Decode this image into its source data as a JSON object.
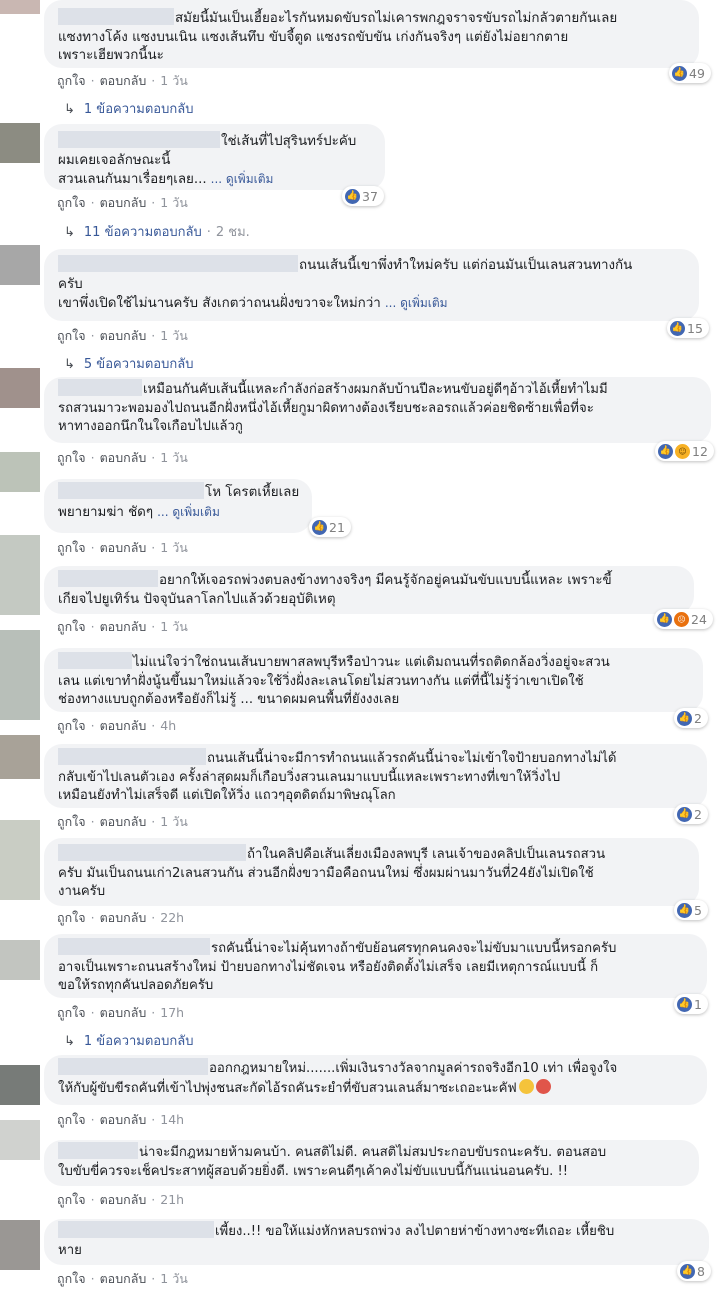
{
  "actions": {
    "like": "ถูกใจ",
    "reply": "ตอบกลับ",
    "sep": "·"
  },
  "more_label": "... ดูเพิ่มเติม",
  "comments": [
    {
      "line1": "สมัยนี้มันเป็นเฮี้ยอะไรกันหมดขับรถไม่เคารพกฎจราจรขับรถไม่กลัวตายกันเลย",
      "line2": "แซงทางโค้ง แซงบนเนิน แซงเส้นทึบ ขับจี้ตูด แซงรถขับขัน เก่งกันจริงๆ แต่ยังไม่อยากตาย",
      "line3": "เพราะเฮียพวกนี้นะ",
      "time": "1 วัน",
      "reactions": "49",
      "replies": "1 ข้อความตอบกลับ",
      "replies_time": ""
    },
    {
      "line1": "ใช่เส้นที่ไปสุรินทร์ปะคับ",
      "line2": "ผมเคยเจอลักษณะนี้",
      "line3": "สวนเลนกันมาเรื่อยๆเลย...",
      "time": "1 วัน",
      "reactions": "37",
      "replies": "11 ข้อความตอบกลับ",
      "replies_time": "2 ชม."
    },
    {
      "line1": "ถนนเส้นนี้เขาพึ่งทำใหม่ครับ แต่ก่อนมันเป็นเลนสวนทางกัน",
      "line2": "ครับ",
      "line3": "เขาพึ่งเปิดใช้ไม่นานครับ สังเกตว่าถนนฝั่งขวาจะใหม่กว่า",
      "time": "1 วัน",
      "reactions": "15",
      "replies": "5 ข้อความตอบกลับ",
      "replies_time": ""
    },
    {
      "line1": "เหมือนกันคับเส้นนี้แหละกำลังก่อสร้างผมกลับบ้านปีละหนขับอยู่ดีๆอ้าวไอ้เหี้ยทำไมมี",
      "line2": "รถสวนมาวะพอมองไปถนนอีกฝั่งหนึ่งไอ้เหี้ยกูมาผิดทางต้องเรียบชะลอรถแล้วค่อยชิดซ้ายเพื่อที่จะ",
      "line3": "หาทางออกนึกในใจเกือบไปแล้วกู",
      "time": "1 วัน",
      "reactions": "12"
    },
    {
      "line1": "โห โครตเหี้ยเลย",
      "line2": "พยายามฆ่า ชัดๆ",
      "time": "1 วัน",
      "reactions": "21"
    },
    {
      "line1": "อยากให้เจอรถพ่วงตบลงข้างทางจริงๆ มีคนรู้จักอยู่คนมันขับแบบนี้แหละ เพราะขี้",
      "line2": "เกียจไปยูเทิร์น ปัจจุบันลาโลกไปแล้วด้วยอุบัติเหตุ",
      "time": "1 วัน",
      "reactions": "24"
    },
    {
      "line1": "ไม่แน่ใจว่าใช่ถนนเส้นบายพาสลพบุรีหรือป่าวนะ แต่เดิมถนนที่รถติดกล้องวิ่งอยู่จะสวน",
      "line2": "เลน แต่เขาทำฝั่งนู้นขึ้นมาใหม่แล้วจะใช้วิ่งฝั่งละเลนโดยไม่สวนทางกัน แต่ที่นี้ไม่รู้ว่าเขาเปิดใช้",
      "line3": "ช่องทางแบบถูกต้องหรือยังก็ไม่รู้ ... ขนาดผมคนพื้นที่ยังงงเลย",
      "time": "4h",
      "reactions": "2"
    },
    {
      "line1": "ถนนเส้นนี้น่าจะมีการทำถนนแล้วรถคันนี้น่าจะไม่เข้าใจป้ายบอกทางไม่ได้",
      "line2": "กลับเข้าไปเลนตัวเอง ครั้งล่าสุดผมก็เกือบวิ่งสวนเลนมาแบบนี้แหละเพราะทางที่เขาให้วิ่งไป",
      "line3": "เหมือนยังทำไม่เสร็จดี แต่เปิดให้วิ่ง แถวๆอุตดิตถ์มาพิษณุโลก",
      "time": "1 วัน",
      "reactions": "2"
    },
    {
      "line1": "ถ้าในคลิปคือเส้นเลี่ยงเมืองลพบุรี เลนเจ้าของคลิปเป็นเลนรถสวน",
      "line2": "ครับ มันเป็นถนนเก่า2เลนสวนกัน ส่วนอีกฝั่งขวามือคือถนนใหม่ ซึ่งผมผ่านมาวันที่24ยังไม่เปิดใช้",
      "line3": "งานครับ",
      "time": "22h",
      "reactions": "5"
    },
    {
      "line1": "รถคันนี้น่าจะไม่คุ้นทางถ้าขับย้อนศรทุกคนคงจะไม่ขับมาแบบนี้หรอกครับ",
      "line2": "อาจเป็นเพราะถนนสร้างใหม่ ป้ายบอกทางไม่ชัดเจน หรือยังติดตั้งไม่เสร็จ เลยมีเหตุการณ์แบบนี้ ก็",
      "line3": "ขอให้รถทุกคันปลอดภัยครับ",
      "time": "17h",
      "reactions": "1",
      "replies": "1 ข้อความตอบกลับ",
      "replies_time": ""
    },
    {
      "line1": "ออกกฎหมายใหม่.......เพิ่มเงินรางวัลจากมูลค่ารถจริงอีก10 เท่า เพื่อจูงใจ",
      "line2": "ให้กับผู้ขับขีรถคันที่เข้าไปพุ่งชนสะกัดไอ้รถคันระยำที่ขับสวนเลนส์มาซะเถอะนะคัฟ",
      "time": "14h"
    },
    {
      "line1": "น่าจะมีกฎหมายห้ามคนบ้า. คนสติไม่ดี. คนสติไม่สมประกอบขับรถนะครับ. ตอนสอบ",
      "line2": "ใบขับขี่ควรจะเช็คประสาทผู้สอบด้วยยิ่งดี. เพราะคนดีๆเค้าคงไม่ขับแบบนี้กันแน่นอนครับ. !!",
      "time": "21h"
    },
    {
      "line1": "เพี้ยง..!! ขอให้แม่งหักหลบรถพ่วง ลงไปตายห่าข้างทางซะทีเถอะ เหี้ยชิบ",
      "line2": "หาย",
      "time": "1 วัน",
      "reactions": "8"
    }
  ]
}
